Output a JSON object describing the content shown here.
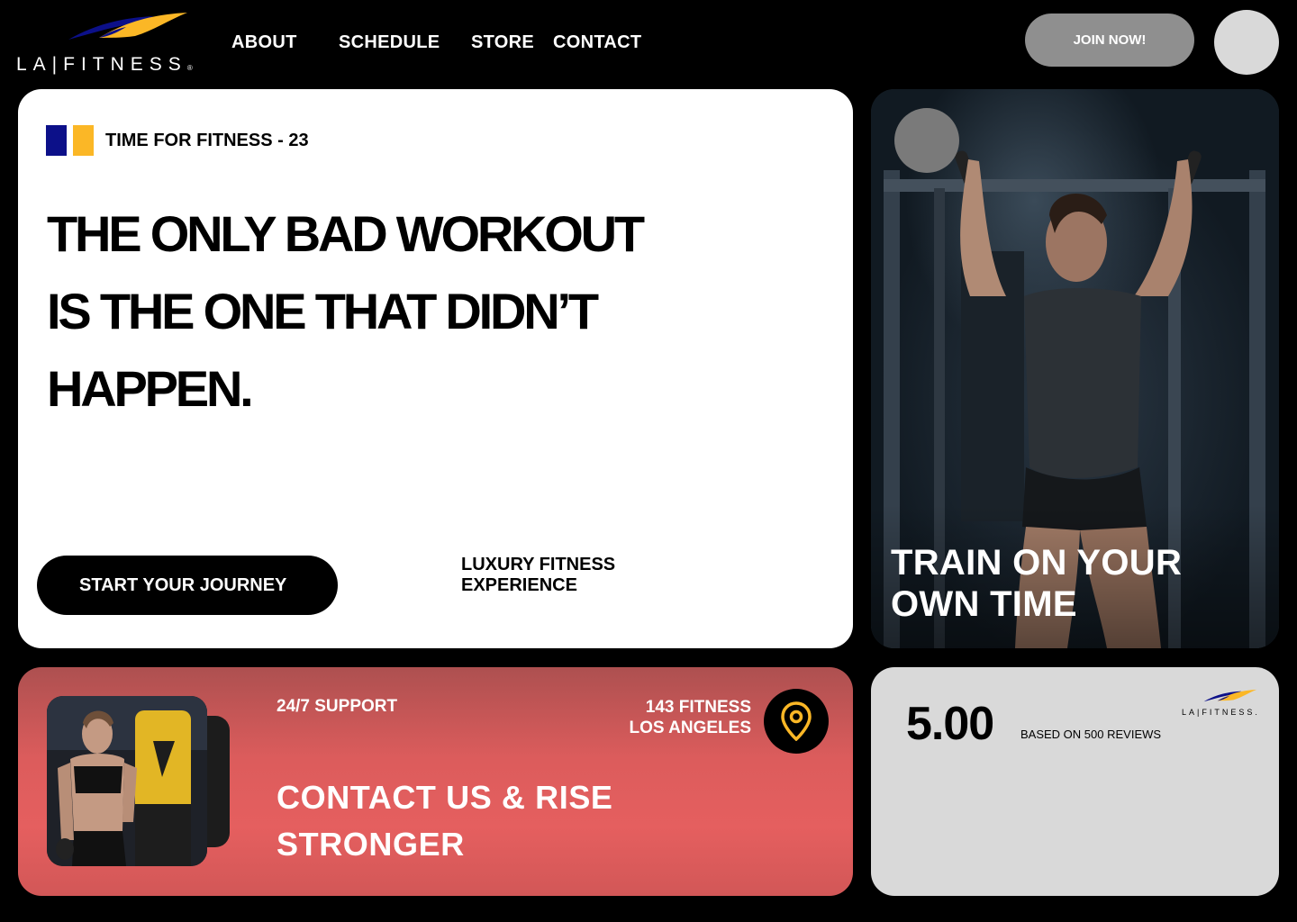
{
  "brand": {
    "logo_text": "LA|FITNESS",
    "logo_mark": "®",
    "colors": {
      "blue": "#0c1089",
      "gold": "#fbb726",
      "coral": "#e55f5f",
      "gray": "#8f8f8f"
    }
  },
  "nav": {
    "items": [
      {
        "label": "ABOUT"
      },
      {
        "label": "SCHEDULE"
      },
      {
        "label": "STORE"
      },
      {
        "label": "CONTACT"
      }
    ],
    "join_label": "JOIN NOW!"
  },
  "hero": {
    "tagline": "TIME FOR FITNESS - 23",
    "headline_lines": [
      "THE ONLY BAD WORKOUT",
      "IS THE ONE THAT DIDN’T",
      "HAPPEN."
    ],
    "cta_label": "START YOUR JOURNEY",
    "luxury_lines": [
      "LUXURY FITNESS",
      "EXPERIENCE"
    ]
  },
  "photo_card": {
    "caption_lines": [
      "TRAIN ON YOUR",
      "OWN TIME"
    ]
  },
  "contact": {
    "support": "24/7 SUPPORT",
    "location_lines": [
      "143 FITNESS",
      "LOS ANGELES"
    ],
    "pin_icon": "location-pin-icon",
    "title_lines": [
      "CONTACT US & RISE",
      "STRONGER"
    ]
  },
  "rating": {
    "score": "5.00",
    "reviews": "BASED ON 500 REVIEWS",
    "logo_text": "LA|FITNESS."
  }
}
